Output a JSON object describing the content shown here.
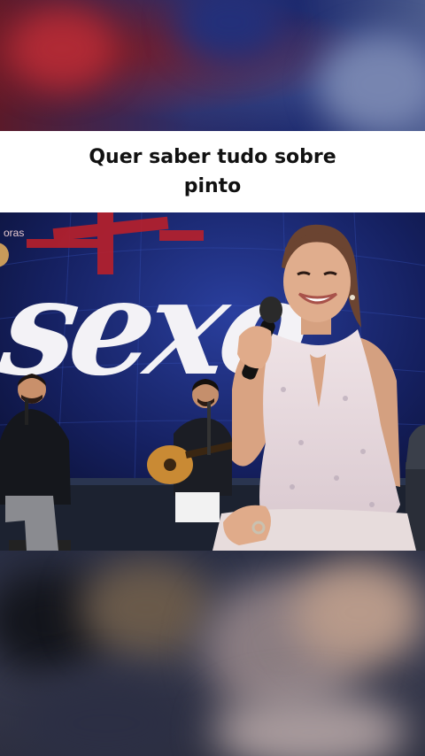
{
  "caption": {
    "text": "Quer saber tudo sobre pinto"
  },
  "video": {
    "channel_tag": "oras",
    "backdrop_word": "sexo"
  },
  "colors": {
    "caption_bg": "#ffffff",
    "caption_text": "#111111",
    "backdrop": "#10163a"
  },
  "icons": [
    "microphone-icon",
    "guitar-icon"
  ]
}
